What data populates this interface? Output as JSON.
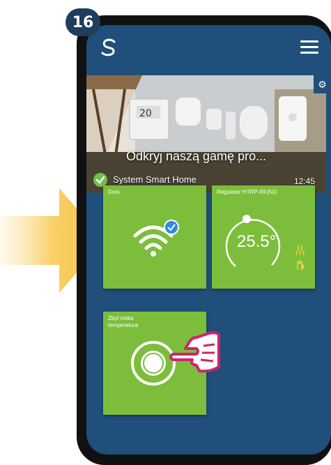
{
  "step_number": "16",
  "banner": {
    "title": "Odkryj naszą gamę pro...",
    "subtitle": "System Smart Home",
    "time": "12:45",
    "thermostat_display": "20"
  },
  "tiles": [
    {
      "label": "Dom",
      "icon": "wifi-connected-icon"
    },
    {
      "label": "Regulator HTRP-RF(50)",
      "temperature": "25.5°",
      "icon": "thermostat-dial-icon"
    },
    {
      "label": "Zbyt niska temperatura",
      "icon": "push-button-icon"
    }
  ],
  "colors": {
    "screen_background": "#1f4f7a",
    "tile_green": "#7cbe3b",
    "check_green": "#6ec04a",
    "badge_blue": "#1f3e5e",
    "arrow_yellow": "#f7c844",
    "check_blue": "#2a8be0"
  }
}
